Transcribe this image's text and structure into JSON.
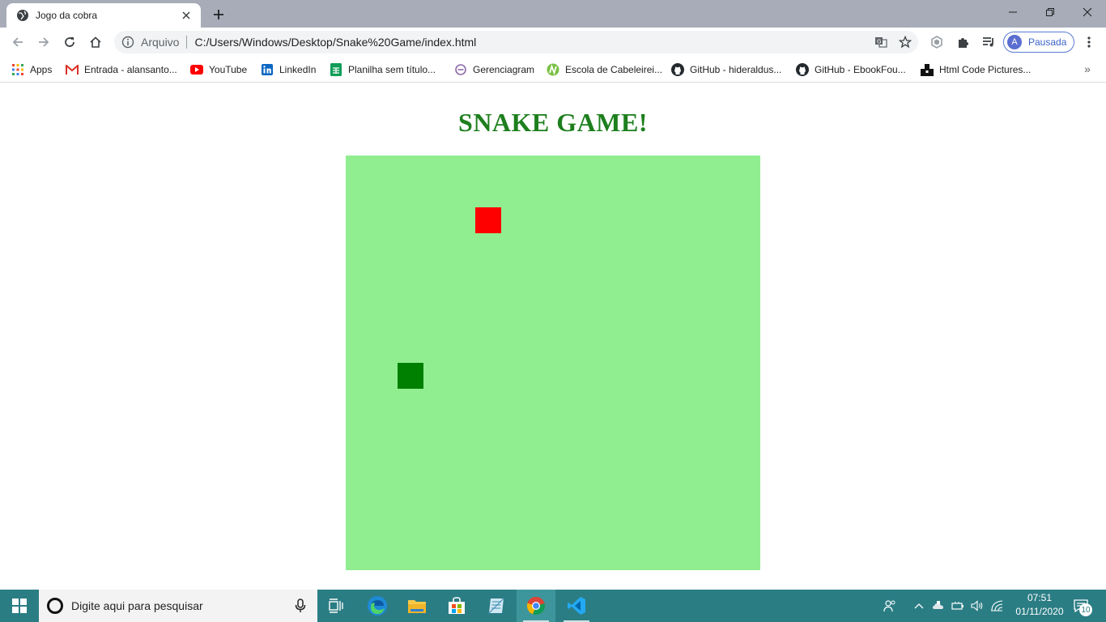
{
  "browser": {
    "tab": {
      "title": "Jogo da cobra",
      "favicon": "globe-icon"
    },
    "window_controls": [
      "minimize-icon",
      "restore-icon",
      "close-icon"
    ],
    "omnibox": {
      "security_label": "Arquivo",
      "url": "C:/Users/Windows/Desktop/Snake%20Game/index.html"
    },
    "profile": {
      "initial": "A",
      "label": "Pausada"
    },
    "bookmarks": [
      {
        "label": "Apps",
        "icon": "apps-grid-icon"
      },
      {
        "label": "Entrada - alansanto...",
        "icon": "gmail-icon"
      },
      {
        "label": "YouTube",
        "icon": "youtube-icon"
      },
      {
        "label": "LinkedIn",
        "icon": "linkedin-icon"
      },
      {
        "label": "Planilha sem título...",
        "icon": "sheets-icon"
      },
      {
        "label": "Gerenciagram",
        "icon": "gerenciagram-icon"
      },
      {
        "label": "Escola de Cabeleirei...",
        "icon": "escola-icon"
      },
      {
        "label": "GitHub - hideraldus...",
        "icon": "github-icon"
      },
      {
        "label": "GitHub - EbookFou...",
        "icon": "github-icon"
      },
      {
        "label": "Html Code Pictures...",
        "icon": "html-code-icon"
      }
    ],
    "bookmarks_overflow": "»"
  },
  "game": {
    "title": "SNAKE GAME!",
    "grid_size": 16,
    "board_color": "#90ee90",
    "food": {
      "col": 5,
      "row": 2,
      "color": "#ff0000"
    },
    "snake": {
      "segments": [
        {
          "col": 2,
          "row": 8
        }
      ],
      "color": "#008000"
    }
  },
  "taskbar": {
    "search_placeholder": "Digite aqui para pesquisar",
    "apps": [
      "task-view-icon",
      "edge-icon",
      "file-explorer-icon",
      "store-icon",
      "notes-icon",
      "chrome-icon",
      "vscode-icon"
    ],
    "clock_time": "07:51",
    "clock_date": "01/11/2020",
    "notification_count": "10"
  }
}
